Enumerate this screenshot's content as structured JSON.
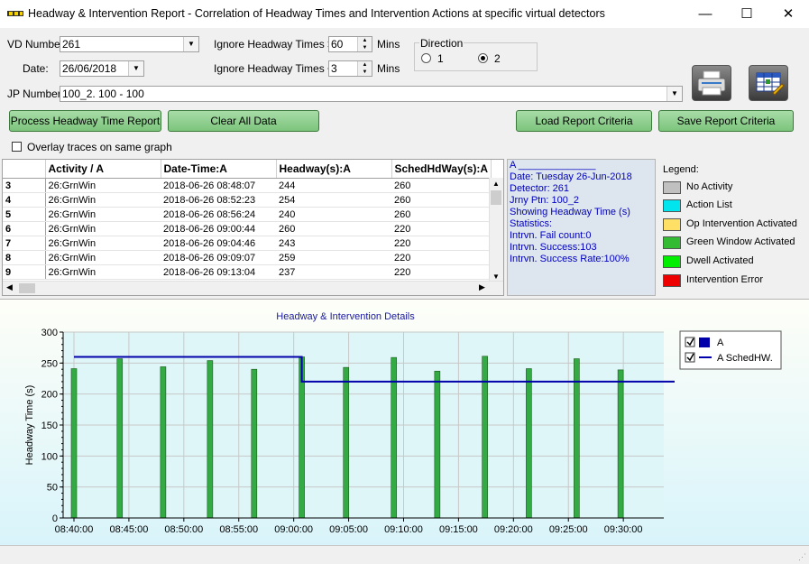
{
  "window": {
    "title": "Headway & Intervention Report - Correlation of Headway Times and Intervention Actions at specific virtual detectors",
    "minimize": "—",
    "maximize": "☐",
    "close": "✕"
  },
  "form": {
    "vd_label": "VD Number",
    "vd_value": "261",
    "date_label": "Date:",
    "date_value": "26/06/2018",
    "ignore_gt_label": "Ignore Headway Times >",
    "ignore_gt_value": "60",
    "ignore_lt_label": "Ignore Headway Times <",
    "ignore_lt_value": "3",
    "mins_label": "Mins",
    "direction_label": "Direction",
    "direction_options": [
      "1",
      "2"
    ],
    "direction_selected": "2",
    "jp_label": "JP Number",
    "jp_value": "100_2. 100 - 100"
  },
  "buttons": {
    "process": "Process  Headway Time Report",
    "clear": "Clear All Data",
    "load": "Load Report Criteria",
    "save": "Save Report Criteria"
  },
  "overlay_label": "Overlay traces on same graph",
  "table": {
    "headers": [
      "Activity / A",
      "Date-Time:A",
      "Headway(s):A",
      "SchedHdWay(s):A"
    ],
    "rows": [
      {
        "n": "3",
        "activity": "26:GrnWin",
        "datetime": "2018-06-26 08:48:07",
        "headway": "244",
        "sched": "260"
      },
      {
        "n": "4",
        "activity": "26:GrnWin",
        "datetime": "2018-06-26 08:52:23",
        "headway": "254",
        "sched": "260"
      },
      {
        "n": "5",
        "activity": "26:GrnWin",
        "datetime": "2018-06-26 08:56:24",
        "headway": "240",
        "sched": "260"
      },
      {
        "n": "6",
        "activity": "26:GrnWin",
        "datetime": "2018-06-26 09:00:44",
        "headway": "260",
        "sched": "220"
      },
      {
        "n": "7",
        "activity": "26:GrnWin",
        "datetime": "2018-06-26 09:04:46",
        "headway": "243",
        "sched": "220"
      },
      {
        "n": "8",
        "activity": "26:GrnWin",
        "datetime": "2018-06-26 09:09:07",
        "headway": "259",
        "sched": "220"
      },
      {
        "n": "9",
        "activity": "26:GrnWin",
        "datetime": "2018-06-26 09:13:04",
        "headway": "237",
        "sched": "220"
      }
    ]
  },
  "stats": {
    "lines": [
      "A ______________",
      "Date:   Tuesday 26-Jun-2018",
      "Detector: 261",
      "Jrny Ptn: 100_2",
      "Showing Headway Time (s)",
      "Statistics:",
      "Intrvn. Fail count:0",
      "Intrvn. Success:103",
      "Intrvn. Success Rate:100%"
    ]
  },
  "legend": {
    "title": "Legend:",
    "items": [
      {
        "label": "No Activity",
        "color": "#c0c0c0"
      },
      {
        "label": "Action List",
        "color": "#00e5ee"
      },
      {
        "label": "Op Intervention Activated",
        "color": "#ffe066"
      },
      {
        "label": "Green Window Activated",
        "color": "#33bb33"
      },
      {
        "label": "Dwell Activated",
        "color": "#00ee00"
      },
      {
        "label": "Intervention Error",
        "color": "#ee0000"
      }
    ]
  },
  "colors": {
    "bar_fill": "#33aa44",
    "sched_line": "#0000aa",
    "title_blue": "#1a1aa0"
  },
  "chart_data": {
    "type": "bar",
    "title": "Headway & Intervention Details",
    "xlabel": "",
    "ylabel": "Headway Time (s)",
    "ylim": [
      0,
      300
    ],
    "yticks": [
      "0",
      "50",
      "100",
      "150",
      "200",
      "250",
      "300"
    ],
    "xlim": [
      "08:40:00",
      "09:34:40"
    ],
    "xticks": [
      "08:40:00",
      "08:45:00",
      "08:50:00",
      "08:55:00",
      "09:00:00",
      "09:05:00",
      "09:10:00",
      "09:15:00",
      "09:20:00",
      "09:25:00",
      "09:30:00"
    ],
    "grid": true,
    "legend_position": "top-right",
    "series": [
      {
        "name": "A",
        "type": "bar",
        "x": [
          "08:40:00",
          "08:44:10",
          "08:48:07",
          "08:52:23",
          "08:56:24",
          "09:00:44",
          "09:04:46",
          "09:09:07",
          "09:13:04",
          "09:17:24",
          "09:21:24",
          "09:25:45",
          "09:29:45"
        ],
        "values": [
          241,
          257,
          244,
          254,
          240,
          260,
          243,
          259,
          237,
          261,
          241,
          257,
          239
        ]
      },
      {
        "name": "A SchedHW.",
        "type": "step",
        "x": [
          "08:40:00",
          "09:00:44",
          "09:00:44",
          "09:34:40"
        ],
        "values": [
          260,
          260,
          220,
          220
        ]
      }
    ]
  }
}
